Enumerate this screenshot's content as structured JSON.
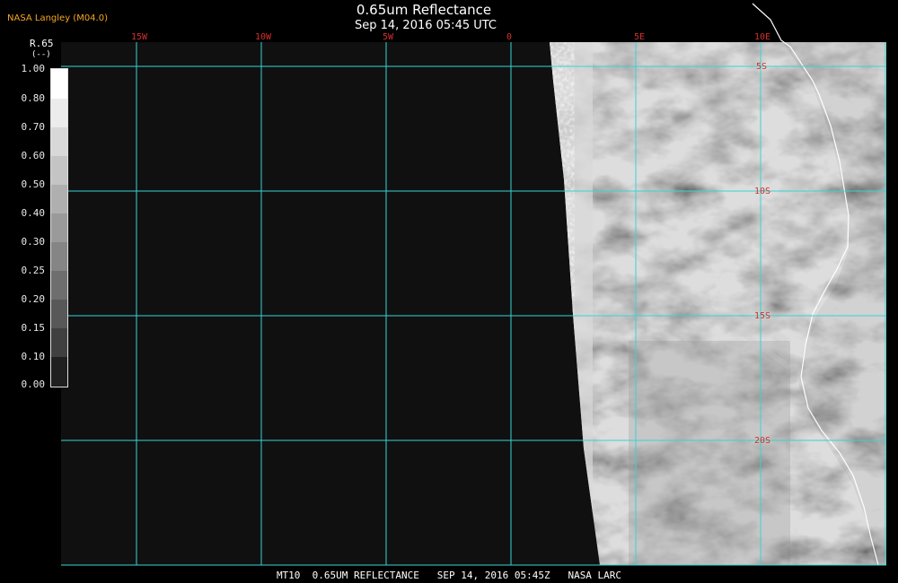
{
  "credit": "NASA Langley (M04.0)",
  "title": "0.65um Reflectance",
  "subtitle": "Sep 14, 2016 05:45 UTC",
  "colorbar": {
    "label_line1": "R.65",
    "label_line2": "(--)",
    "ticks": [
      "1.00",
      "0.80",
      "0.70",
      "0.60",
      "0.50",
      "0.40",
      "0.30",
      "0.25",
      "0.20",
      "0.15",
      "0.10",
      "0.00"
    ]
  },
  "longitude_labels": [
    "15W",
    "10W",
    "5W",
    "0",
    "5E",
    "10E"
  ],
  "latitude_labels": [
    "5S",
    "10S",
    "15S",
    "20S"
  ],
  "footer": "MT10  0.65UM REFLECTANCE   SEP 14, 2016 05:45Z   NASA LARC",
  "colors": {
    "grid": "#39d3d3",
    "coord_labels": "#d4302a",
    "credit": "#f5a623"
  }
}
